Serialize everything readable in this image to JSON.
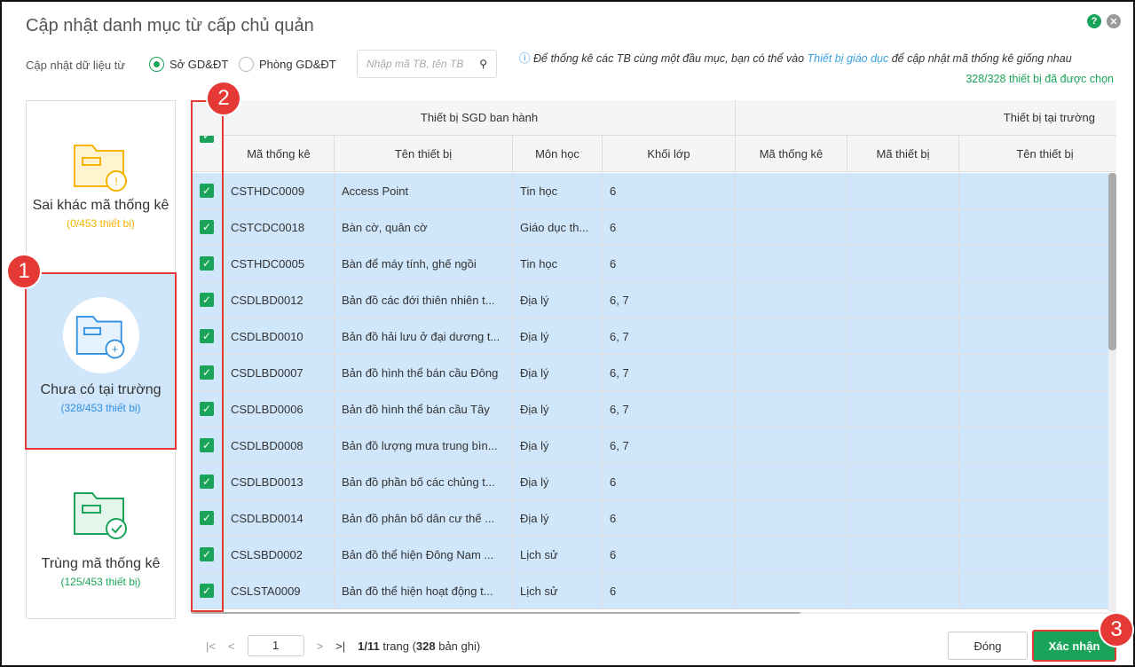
{
  "title": "Cập nhật danh mục từ cấp chủ quản",
  "source_label": "Cập nhật dữ liệu từ",
  "radios": [
    {
      "label": "Sở GD&ĐT",
      "selected": true
    },
    {
      "label": "Phòng GD&ĐT",
      "selected": false
    }
  ],
  "search_placeholder": "Nhập mã TB, tên TB",
  "info": {
    "before": "Để thống kê các TB cùng một đầu mục, bạn có thể vào ",
    "link": "Thiết bị giáo dục",
    "after": " để cập nhật mã thống kê giống nhau"
  },
  "selected_count": "328/328 thiết bị đã được chọn",
  "categories": [
    {
      "name": "Sai khác mã thống kê",
      "count": "(0/453 thiết bị)",
      "color": "#f5b400"
    },
    {
      "name": "Chưa có tại trường",
      "count": "(328/453 thiết bị)",
      "color": "#2f8fe0"
    },
    {
      "name": "Trùng mã thống kê",
      "count": "(125/453 thiết bị)",
      "color": "#1aa45a"
    }
  ],
  "table": {
    "group1": "Thiết bị SGD ban hành",
    "group2": "Thiết bị tại trường",
    "columns": [
      "Mã thống kê",
      "Tên thiết bị",
      "Môn học",
      "Khối lớp",
      "Mã thống kê",
      "Mã thiết bị",
      "Tên thiết bị"
    ],
    "rows": [
      [
        "CSTHDC0009",
        "Access Point",
        "Tin học",
        "6"
      ],
      [
        "CSTCDC0018",
        "Bàn cờ, quân cờ",
        "Giáo dục th...",
        "6"
      ],
      [
        "CSTHDC0005",
        "Bàn để máy tính, ghế ngồi",
        "Tin học",
        "6"
      ],
      [
        "CSDLBD0012",
        "Bản đồ các đới thiên nhiên t...",
        "Địa lý",
        "6, 7"
      ],
      [
        "CSDLBD0010",
        "Bản đồ hải lưu ở đại dương t...",
        "Địa lý",
        "6, 7"
      ],
      [
        "CSDLBD0007",
        "Bản đồ hình thể bán cầu Đông",
        "Địa lý",
        "6, 7"
      ],
      [
        "CSDLBD0006",
        "Bản đồ hình thể bán cầu Tây",
        "Địa lý",
        "6, 7"
      ],
      [
        "CSDLBD0008",
        "Bản đồ lượng mưa trung bìn...",
        "Địa lý",
        "6, 7"
      ],
      [
        "CSDLBD0013",
        "Bản đồ phần bố các chủng t...",
        "Địa lý",
        "6"
      ],
      [
        "CSDLBD0014",
        "Bản đồ phân bố dân cư thế ...",
        "Địa lý",
        "6"
      ],
      [
        "CSLSBD0002",
        "Bản đồ thể hiện Đông Nam ...",
        "Lịch sử",
        "6"
      ],
      [
        "CSLSTA0009",
        "Bản đồ thể hiện hoạt động t...",
        "Lịch sử",
        "6"
      ]
    ]
  },
  "pager": {
    "page": "1",
    "total": "1/11",
    "trang": " trang (",
    "records": "328",
    "suffix": " bản ghi)"
  },
  "buttons": {
    "close": "Đóng",
    "confirm": "Xác nhận"
  },
  "badges": [
    "1",
    "2",
    "3"
  ]
}
